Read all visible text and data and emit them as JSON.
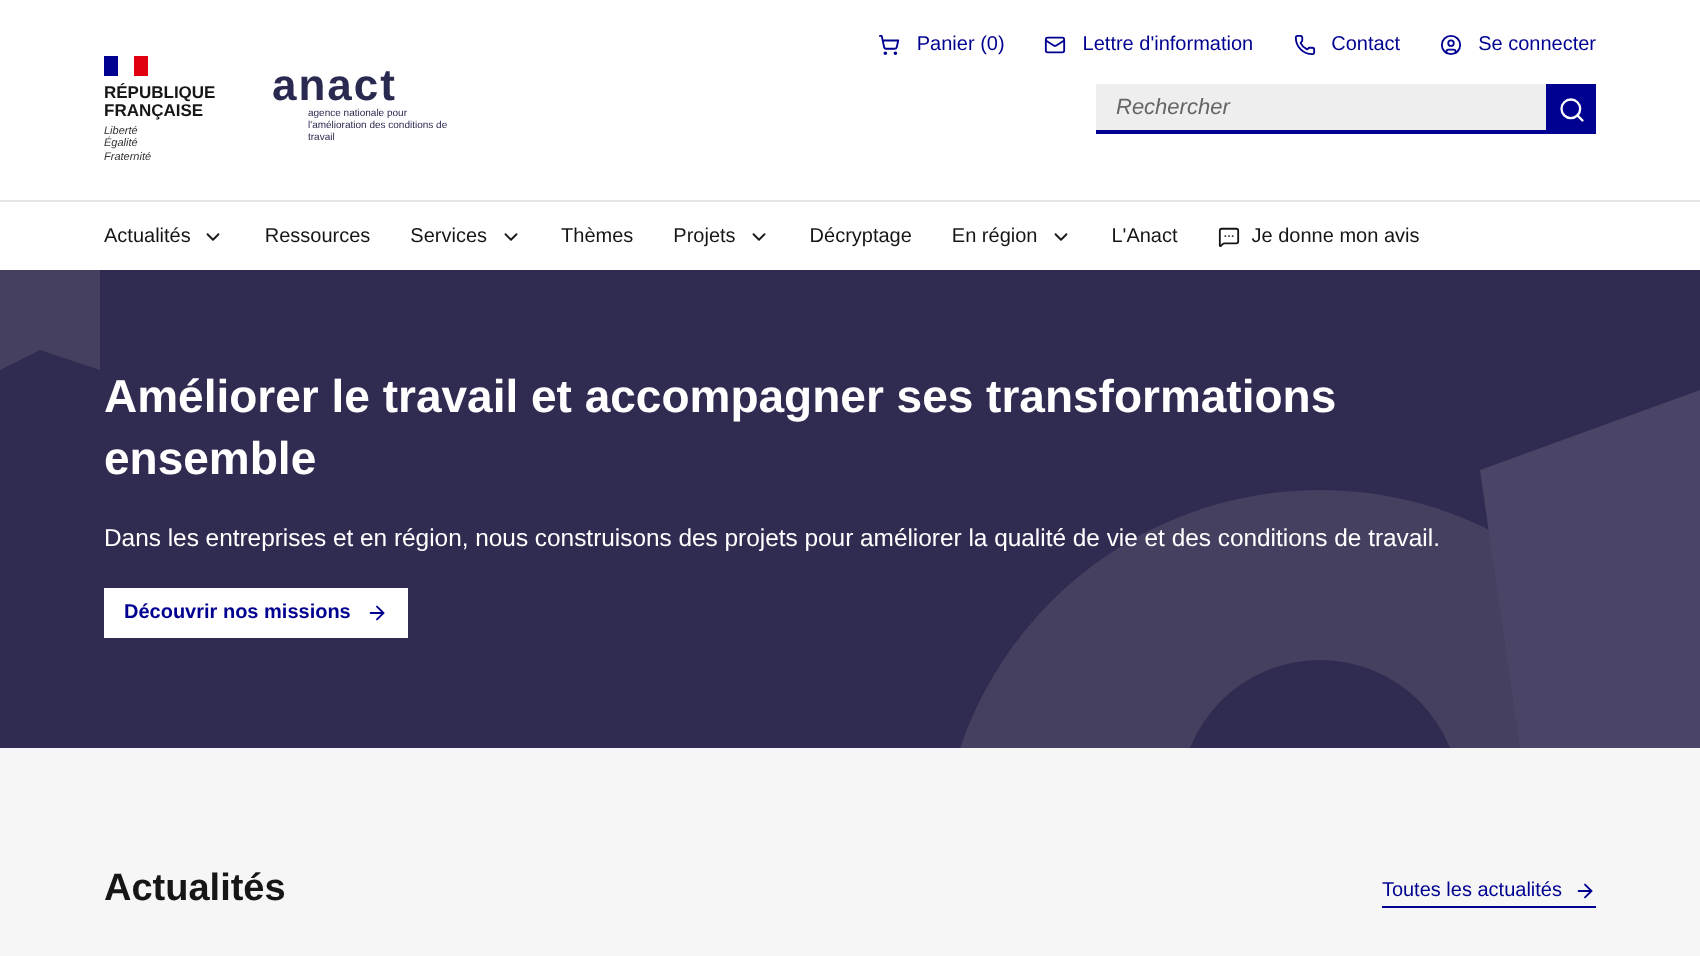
{
  "header": {
    "brand": {
      "republic": "RÉPUBLIQUE FRANÇAISE",
      "motto": [
        "Liberté",
        "Égalité",
        "Fraternité"
      ],
      "logo": "anact",
      "tagline": "agence nationale pour l'amélioration des conditions de travail"
    },
    "quick_links": [
      {
        "kind": "cart",
        "label": "Panier (0)"
      },
      {
        "kind": "mail",
        "label": "Lettre d'information"
      },
      {
        "kind": "phone",
        "label": "Contact"
      },
      {
        "kind": "user",
        "label": "Se connecter"
      }
    ],
    "search": {
      "placeholder": "Rechercher"
    }
  },
  "nav": [
    {
      "kind": "link",
      "label": "Actualités",
      "dropdown": true
    },
    {
      "kind": "link",
      "label": "Ressources",
      "dropdown": false
    },
    {
      "kind": "link",
      "label": "Services",
      "dropdown": true
    },
    {
      "kind": "link",
      "label": "Thèmes",
      "dropdown": false
    },
    {
      "kind": "link",
      "label": "Projets",
      "dropdown": true
    },
    {
      "kind": "link",
      "label": "Décryptage",
      "dropdown": false
    },
    {
      "kind": "link",
      "label": "En région",
      "dropdown": true
    },
    {
      "kind": "link",
      "label": "L'Anact",
      "dropdown": false
    },
    {
      "kind": "feedback",
      "label": "Je donne mon avis",
      "dropdown": false
    }
  ],
  "hero": {
    "title": "Améliorer le travail et accompagner ses transformations ensemble",
    "text": "Dans les entreprises et en région, nous construisons des projets pour améliorer la qualité de vie et des conditions de travail.",
    "button": "Découvrir nos missions"
  },
  "news": {
    "title": "Actualités",
    "link": "Toutes les actualités"
  }
}
